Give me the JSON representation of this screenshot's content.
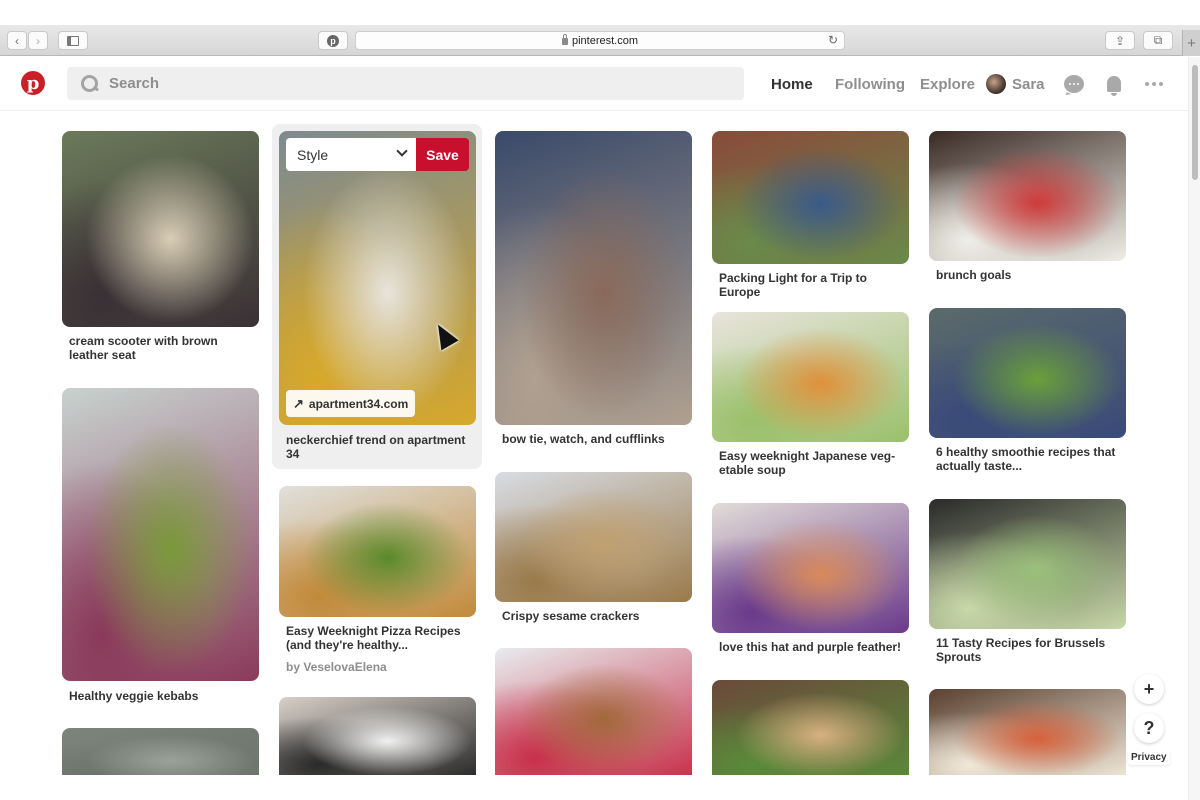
{
  "browser": {
    "url": "pinterest.com",
    "back_icon": "chevron-left-icon",
    "forward_icon": "chevron-right-icon",
    "sidebar_icon": "sidebar-icon",
    "site_icon": "pinterest-icon",
    "reload_icon": "reload-icon",
    "share_icon": "share-icon",
    "tabs_icon": "tabs-icon",
    "new_tab_label": "+"
  },
  "header": {
    "logo_glyph": "p",
    "search_placeholder": "Search",
    "nav": [
      {
        "label": "Home",
        "active": true
      },
      {
        "label": "Following",
        "active": false
      },
      {
        "label": "Explore",
        "active": false
      }
    ],
    "user_name": "Sara"
  },
  "hover_pin": {
    "board_select": "Style",
    "save_label": "Save",
    "source_link": "apartment34.com"
  },
  "pins": [
    {
      "title": "cream scooter with brown leather seat",
      "colors": [
        "#6b7a5a",
        "#d9cdb5",
        "#3a3035"
      ]
    },
    {
      "title": "Healthy veggie kebabs",
      "colors": [
        "#c8d2cf",
        "#7a9a3a",
        "#8a3a5a"
      ]
    },
    {
      "title": "",
      "colors": [
        "#7d847c",
        "#9aa39a",
        "#6c736b"
      ]
    },
    {
      "title": "neckerchief trend on apartment 34",
      "colors": [
        "#7d8a90",
        "#e8e4dc",
        "#d7a82a"
      ]
    },
    {
      "title": "Easy Weeknight Pizza Recipes (and they're healthy...",
      "by": "by VeselovaElena",
      "colors": [
        "#e0e0dc",
        "#5a8a2a",
        "#c28a3a"
      ]
    },
    {
      "title": "",
      "colors": [
        "#d8d0c8",
        "#f1f1f1",
        "#2a2a2a"
      ]
    },
    {
      "title": "bow tie, watch, and cufflinks",
      "colors": [
        "#3a4a6a",
        "#8a6a5a",
        "#b0a090"
      ]
    },
    {
      "title": "Crispy sesame crackers",
      "colors": [
        "#d8dce3",
        "#c0a070",
        "#9a7a4a"
      ]
    },
    {
      "title": "",
      "colors": [
        "#e8ecee",
        "#a2683a",
        "#c8304a"
      ]
    },
    {
      "title": "Packing Light for a Trip to Europe",
      "colors": [
        "#8a4a3a",
        "#3a5a8a",
        "#6a8a4a"
      ]
    },
    {
      "title": "Easy weeknight Japanese veg-etable soup",
      "colors": [
        "#e8e4dc",
        "#e0903a",
        "#9ac06a"
      ]
    },
    {
      "title": "love this hat and purple feather!",
      "colors": [
        "#e2dcd8",
        "#d98a5a",
        "#6a3a8a"
      ]
    },
    {
      "title": "",
      "colors": [
        "#6a4a3a",
        "#d8b080",
        "#5a8a3a"
      ]
    },
    {
      "title": "brunch goals",
      "colors": [
        "#3a2a24",
        "#d03a3a",
        "#f0eee8"
      ]
    },
    {
      "title": "6 healthy smoothie recipes that actually taste...",
      "colors": [
        "#5a6a6a",
        "#6aa03a",
        "#3a4a7a"
      ]
    },
    {
      "title": "11 Tasty Recipes for Brussels Sprouts",
      "colors": [
        "#2a2a2a",
        "#9ac07a",
        "#c8d8a8"
      ]
    },
    {
      "title": "",
      "colors": [
        "#5a4030",
        "#d8603a",
        "#f0e8d8"
      ]
    }
  ],
  "floating": {
    "add_label": "+",
    "help_label": "?",
    "privacy_label": "Privacy"
  }
}
